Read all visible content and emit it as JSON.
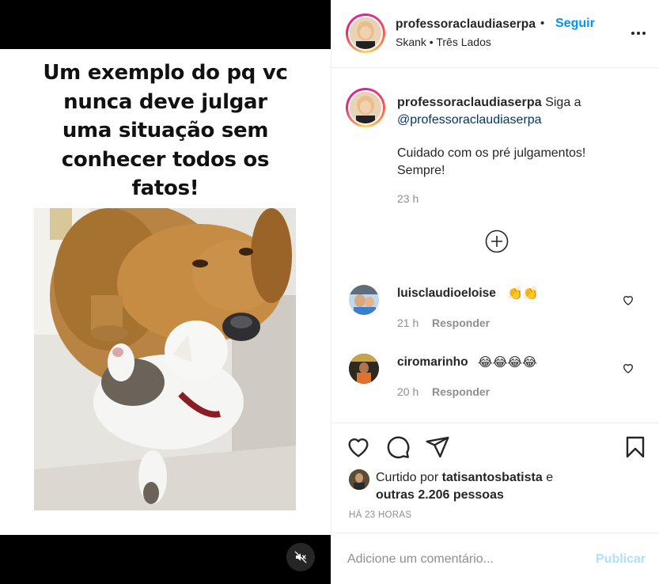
{
  "media": {
    "caption_overlay": "Um exemplo do pq vc\nnunca deve julgar\numa situação sem\nconhecer todos os\nfatos!",
    "mute_icon": "speaker-muted-icon"
  },
  "header": {
    "username": "professoraclaudiaserpa",
    "separator": "•",
    "follow_label": "Seguir",
    "song": "Skank • Três Lados",
    "more_icon": "more-horizontal-icon"
  },
  "caption": {
    "username": "professoraclaudiaserpa",
    "text_before_mention": "Siga a",
    "mention": "@professoraclaudiaserpa",
    "body": "Cuidado com os pré julgamentos!\nSempre!",
    "time": "23 h",
    "load_more_icon": "plus-circle-icon"
  },
  "comments": [
    {
      "username": "luisclaudioeloise",
      "text": "👏👏",
      "time": "21 h",
      "reply_label": "Responder"
    },
    {
      "username": "ciromarinho",
      "text": "😂😂😂😂",
      "time": "20 h",
      "reply_label": "Responder"
    }
  ],
  "actions": {
    "like_icon": "heart-icon",
    "comment_icon": "comment-icon",
    "share_icon": "paper-plane-icon",
    "save_icon": "bookmark-icon",
    "liked_by_prefix": "Curtido por",
    "liked_by_user": "tatisantosbatista",
    "liked_by_conj": "e",
    "liked_by_others": "outras 2.206 pessoas",
    "time_ago": "HÁ 23 HORAS"
  },
  "add_comment": {
    "placeholder": "Adicione um comentário...",
    "publish_label": "Publicar"
  },
  "colors": {
    "accent": "#0095f6",
    "publish_disabled": "#b2dffc",
    "muted_text": "#8e8e8e",
    "mention": "#00376b"
  }
}
